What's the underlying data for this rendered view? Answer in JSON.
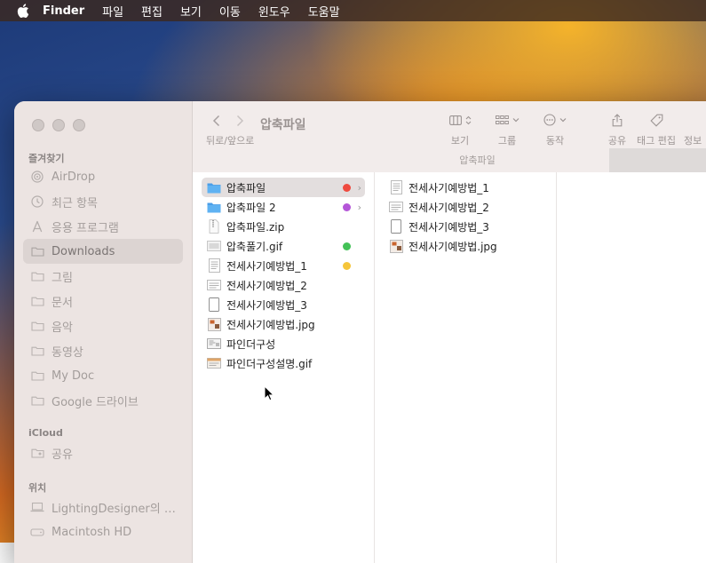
{
  "menubar": {
    "apple_icon": "apple-icon",
    "app": "Finder",
    "items": [
      "파일",
      "편집",
      "보기",
      "이동",
      "윈도우",
      "도움말"
    ]
  },
  "sidebar": {
    "favorites_title": "즐겨찾기",
    "favorites": [
      {
        "label": "AirDrop",
        "icon": "airdrop-icon"
      },
      {
        "label": "최근 항목",
        "icon": "clock-icon"
      },
      {
        "label": "응용 프로그램",
        "icon": "applications-icon"
      },
      {
        "label": "Downloads",
        "icon": "folder-icon",
        "active": true
      },
      {
        "label": "그림",
        "icon": "folder-icon"
      },
      {
        "label": "문서",
        "icon": "folder-icon"
      },
      {
        "label": "음악",
        "icon": "folder-icon"
      },
      {
        "label": "동영상",
        "icon": "folder-icon"
      },
      {
        "label": "My Doc",
        "icon": "folder-icon"
      },
      {
        "label": "Google 드라이브",
        "icon": "folder-icon"
      }
    ],
    "icloud_title": "iCloud",
    "icloud": [
      {
        "label": "공유",
        "icon": "shared-folder-icon"
      }
    ],
    "locations_title": "위치",
    "locations": [
      {
        "label": "LightingDesigner의 M...",
        "icon": "laptop-icon"
      },
      {
        "label": "Macintosh HD",
        "icon": "disk-icon"
      }
    ]
  },
  "toolbar": {
    "nav_label": "뒤로/앞으로",
    "title": "압축파일",
    "view_label": "보기",
    "group_label": "그룹",
    "action_label": "동작",
    "share_label": "공유",
    "tag_label": "태그 편집",
    "info_label": "정보",
    "path": "압축파일"
  },
  "column1": [
    {
      "name": "압축파일",
      "icon": "folder",
      "selected": true,
      "tag": "#ef4a3f",
      "has_children": true
    },
    {
      "name": "압축파일 2",
      "icon": "folder",
      "tag": "#b456d8",
      "has_children": true
    },
    {
      "name": "압축파일.zip",
      "icon": "zip"
    },
    {
      "name": "압축풀기.gif",
      "icon": "image",
      "tag": "#43c257"
    },
    {
      "name": "전세사기예방법_1",
      "icon": "doc",
      "tag": "#f5c53a"
    },
    {
      "name": "전세사기예방법_2",
      "icon": "slide"
    },
    {
      "name": "전세사기예방법_3",
      "icon": "page"
    },
    {
      "name": "전세사기예방법.jpg",
      "icon": "photo"
    },
    {
      "name": "파인더구성",
      "icon": "image"
    },
    {
      "name": "파인더구성설명.gif",
      "icon": "photo"
    }
  ],
  "column2": [
    {
      "name": "전세사기예방법_1",
      "icon": "doc"
    },
    {
      "name": "전세사기예방법_2",
      "icon": "slide"
    },
    {
      "name": "전세사기예방법_3",
      "icon": "page"
    },
    {
      "name": "전세사기예방법.jpg",
      "icon": "photo"
    }
  ]
}
